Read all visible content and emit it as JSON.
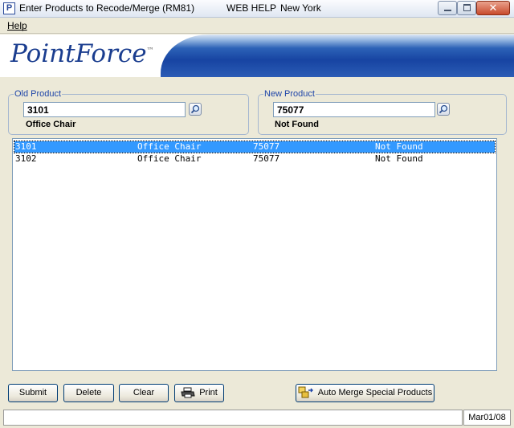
{
  "window": {
    "app_icon": "P",
    "title": "Enter Products to Recode/Merge (RM81)",
    "help_text": "WEB HELP",
    "location": "New York",
    "close_glyph": "✕"
  },
  "menu": {
    "help": "Help"
  },
  "banner": {
    "logo": "PointForce",
    "logo_mark": "™"
  },
  "old_product": {
    "legend": "Old Product",
    "value": "3101",
    "description": "Office Chair"
  },
  "new_product": {
    "legend": "New Product",
    "value": "75077",
    "description": "Not Found"
  },
  "list": {
    "rows": [
      {
        "old": "3101",
        "old_desc": "Office Chair",
        "new": "75077",
        "new_desc": "Not Found",
        "selected": true
      },
      {
        "old": "3102",
        "old_desc": "Office Chair",
        "new": "75077",
        "new_desc": "Not Found",
        "selected": false
      }
    ]
  },
  "buttons": {
    "submit": "Submit",
    "delete": "Delete",
    "clear": "Clear",
    "print": "Print",
    "auto_merge": "Auto Merge Special Products"
  },
  "icons": {
    "app": "app-icon",
    "lookup": "magnifier-icon",
    "print": "printer-icon",
    "auto_merge": "merge-icon"
  },
  "status": {
    "date": "Mar01/08"
  },
  "colors": {
    "selection": "#3399ff",
    "banner_blue": "#1744a2",
    "logo_blue": "#1a3d8f"
  }
}
